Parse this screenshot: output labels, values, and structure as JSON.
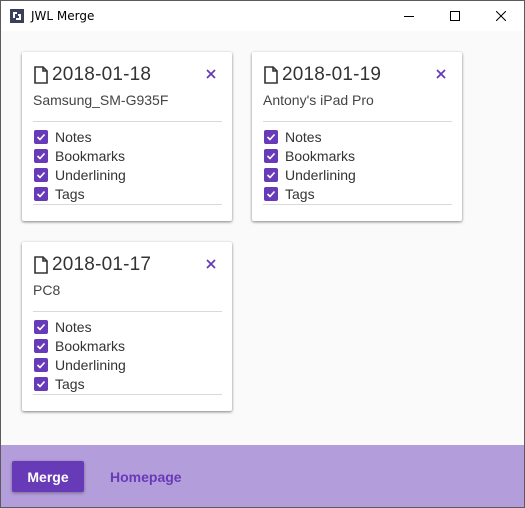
{
  "window": {
    "title": "JWL Merge",
    "controls": [
      "minimize-icon",
      "maximize-icon",
      "close-icon"
    ]
  },
  "colors": {
    "accent": "#673ab7",
    "footer_bg": "#b39ddb",
    "content_bg": "#fafafa"
  },
  "cards": [
    {
      "date": "2018-01-19",
      "device": "Antony's iPad Pro",
      "options": [
        {
          "label": "Notes",
          "checked": true
        },
        {
          "label": "Bookmarks",
          "checked": true
        },
        {
          "label": "Underlining",
          "checked": true
        },
        {
          "label": "Tags",
          "checked": true
        }
      ]
    },
    {
      "date": "2018-01-18",
      "device": "Samsung_SM-G935F",
      "options": [
        {
          "label": "Notes",
          "checked": true
        },
        {
          "label": "Bookmarks",
          "checked": true
        },
        {
          "label": "Underlining",
          "checked": true
        },
        {
          "label": "Tags",
          "checked": true
        }
      ]
    },
    {
      "date": "2018-01-17",
      "device": "PC8",
      "options": [
        {
          "label": "Notes",
          "checked": true
        },
        {
          "label": "Bookmarks",
          "checked": true
        },
        {
          "label": "Underlining",
          "checked": true
        },
        {
          "label": "Tags",
          "checked": true
        }
      ]
    }
  ],
  "footer": {
    "merge_label": "Merge",
    "homepage_label": "Homepage"
  }
}
